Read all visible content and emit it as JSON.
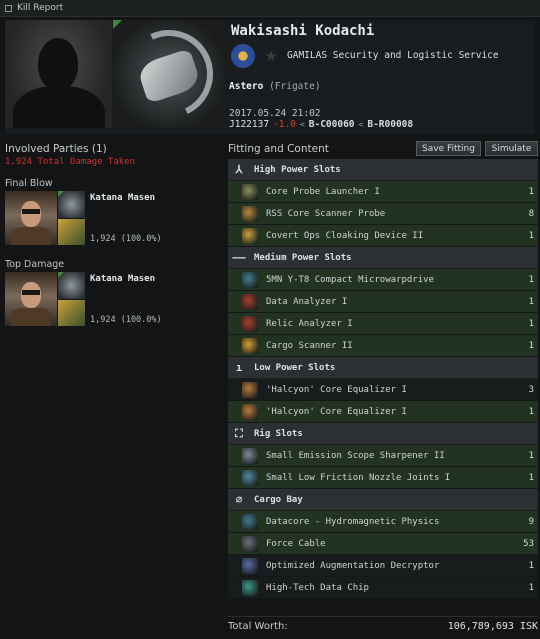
{
  "window": {
    "title": "Kill Report"
  },
  "victim": {
    "name": "Wakisashi Kodachi",
    "corporation": "GAMILAS Security and Logistic Service",
    "ship": "Astero",
    "ship_class": "(Frigate)",
    "time": "2017.05.24 21:02",
    "system": "J122137",
    "security": "-1.0",
    "constellation": "B-C00060",
    "region": "B-R00008"
  },
  "involved": {
    "title": "Involved Parties (1)",
    "damage_taken": "1,924 Total Damage Taken",
    "final_blow": {
      "label": "Final Blow",
      "name": "Katana Masen",
      "damage": "1,924 (100.0%)"
    },
    "top_damage": {
      "label": "Top Damage",
      "name": "Katana Masen",
      "damage": "1,924 (100.0%)"
    }
  },
  "fitting": {
    "title": "Fitting and Content",
    "save_label": "Save Fitting",
    "simulate_label": "Simulate",
    "sections": [
      {
        "name": "High Power Slots",
        "icon": "high-slot-icon",
        "glyph": "⅄",
        "items": [
          {
            "name": "Core Probe Launcher I",
            "qty": "1",
            "state": "green",
            "color": "#8a8f5a"
          },
          {
            "name": "RSS Core Scanner Probe",
            "qty": "8",
            "state": "green",
            "color": "#b58a3a"
          },
          {
            "name": "Covert Ops Cloaking Device II",
            "qty": "1",
            "state": "green",
            "color": "#c7a13d"
          }
        ]
      },
      {
        "name": "Medium Power Slots",
        "icon": "mid-slot-icon",
        "glyph": "‒‒",
        "items": [
          {
            "name": "5MN Y-T8 Compact Microwarpdrive",
            "qty": "1",
            "state": "green",
            "color": "#3f7f8a"
          },
          {
            "name": "Data Analyzer I",
            "qty": "1",
            "state": "green",
            "color": "#a6402e"
          },
          {
            "name": "Relic Analyzer I",
            "qty": "1",
            "state": "green",
            "color": "#a6402e"
          },
          {
            "name": "Cargo Scanner II",
            "qty": "1",
            "state": "green",
            "color": "#d0a031"
          }
        ]
      },
      {
        "name": "Low Power Slots",
        "icon": "low-slot-icon",
        "glyph": "ı",
        "items": [
          {
            "name": "'Halcyon' Core Equalizer I",
            "qty": "3",
            "state": "plain",
            "color": "#b67a3a"
          },
          {
            "name": "'Halcyon' Core Equalizer I",
            "qty": "1",
            "state": "green",
            "color": "#b67a3a"
          }
        ]
      },
      {
        "name": "Rig Slots",
        "icon": "rig-slot-icon",
        "glyph": "⛶",
        "items": [
          {
            "name": "Small Emission Scope Sharpener II",
            "qty": "1",
            "state": "green",
            "color": "#7d8a94"
          },
          {
            "name": "Small Low Friction Nozzle Joints I",
            "qty": "1",
            "state": "green",
            "color": "#4f8a9a"
          }
        ]
      },
      {
        "name": "Cargo Bay",
        "icon": "cargo-bay-icon",
        "glyph": "⌀",
        "items": [
          {
            "name": "Datacore - Hydromagnetic Physics",
            "qty": "9",
            "state": "green",
            "color": "#3f7a8a"
          },
          {
            "name": "Force Cable",
            "qty": "53",
            "state": "green",
            "color": "#6a7075"
          },
          {
            "name": "Optimized Augmentation Decryptor",
            "qty": "1",
            "state": "plain",
            "color": "#5a6aa8"
          },
          {
            "name": "High-Tech Data Chip",
            "qty": "1",
            "state": "plain",
            "color": "#3a9a8a"
          }
        ]
      }
    ]
  },
  "total": {
    "label": "Total Worth:",
    "value": "106,789,693  ISK"
  }
}
